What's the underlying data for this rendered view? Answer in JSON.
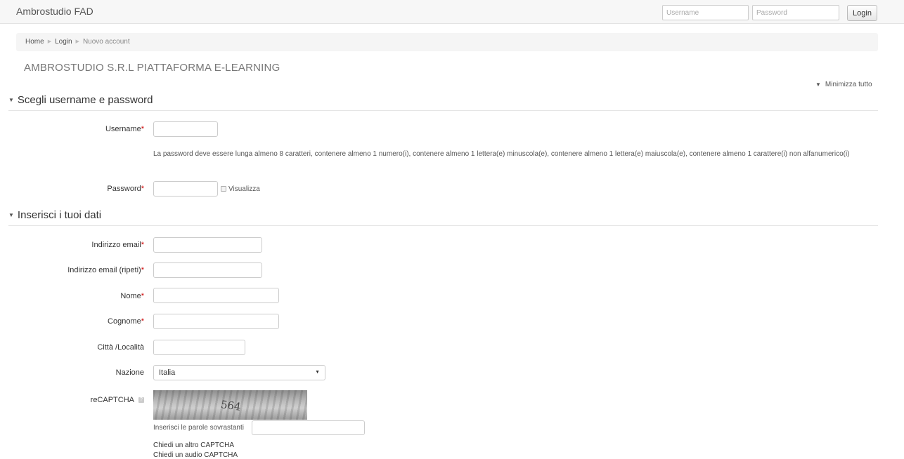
{
  "header": {
    "brand": "Ambrostudio FAD",
    "username_placeholder": "Username",
    "password_placeholder": "Password",
    "login_label": "Login"
  },
  "breadcrumb": [
    "Home",
    "Login",
    "Nuovo account"
  ],
  "page_title": "AMBROSTUDIO S.R.L PIATTAFORMA E-LEARNING",
  "collapse_all": "Minimizza tutto",
  "sections": {
    "credentials": "Scegli username e password",
    "personal": "Inserisci i tuoi dati"
  },
  "form": {
    "username_label": "Username",
    "password_hint": "La password deve essere lunga almeno 8 caratteri, contenere almeno 1 numero(i), contenere almeno 1 lettera(e) minuscola(e), contenere almeno 1 lettera(e) maiuscola(e), contenere almeno 1 carattere(i) non alfanumerico(i)",
    "password_label": "Password",
    "show_password": "Visualizza",
    "email_label": "Indirizzo email",
    "email_repeat_label": "Indirizzo email (ripeti)",
    "name_label": "Nome",
    "surname_label": "Cognome",
    "city_label": "Città /Località",
    "country_label": "Nazione",
    "country_value": "Italia",
    "captcha_label": "reCAPTCHA",
    "captcha_text": "564",
    "captcha_prompt": "Inserisci le parole sovrastanti",
    "captcha_new": "Chiedi un altro CAPTCHA",
    "captcha_audio": "Chiedi un audio CAPTCHA",
    "required_mark": "*"
  },
  "colors": {
    "required": "#cc0000",
    "navbar": "#f7f7f7"
  }
}
